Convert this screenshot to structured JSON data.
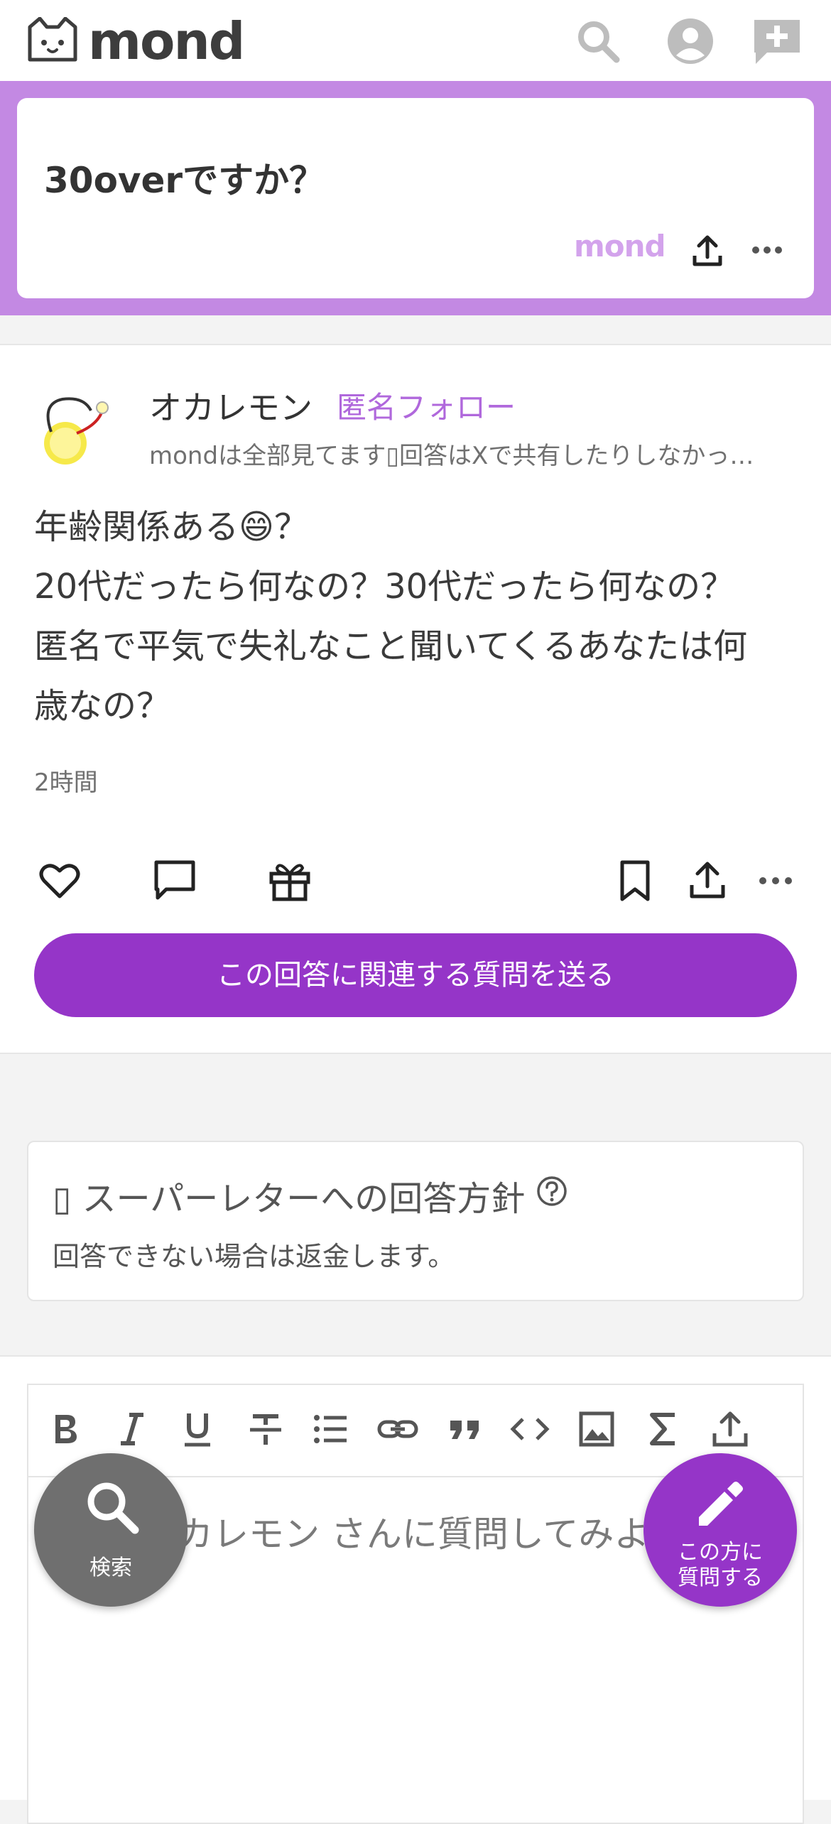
{
  "header": {
    "logo_text": "mond",
    "icons": [
      "search-icon",
      "account-icon",
      "new-question-icon"
    ]
  },
  "question": {
    "text": "30overですか？",
    "watermark": "mond"
  },
  "answer": {
    "user_name": "オカレモン",
    "follow_label": "匿名フォロー",
    "bio": "mondは全部見てます▯回答はXで共有したりしなかっ…",
    "body_lines": [
      "年齢関係ある😄？",
      "20代だったら何なの？30代だったら何なの？",
      "匿名で平気で失礼なこと聞いてくるあなたは何",
      "歳なの？"
    ],
    "time_ago": "2時間",
    "cta_label": "この回答に関連する質問を送る"
  },
  "policy": {
    "title": "▯ スーパーレターへの回答方針",
    "subtitle": "回答できない場合は返金します。"
  },
  "editor": {
    "placeholder": "オカレモン さんに質問してみよう",
    "toolbar": [
      "bold",
      "italic",
      "underline",
      "strikethrough",
      "bullet-list",
      "link",
      "quote",
      "code",
      "image",
      "sigma",
      "upload"
    ]
  },
  "fab": {
    "search_label": "検索",
    "ask_label_line1": "この方に",
    "ask_label_line2": "質問する"
  },
  "colors": {
    "accent": "#9535c8",
    "banner": "#c389e3",
    "follow": "#b068dc"
  }
}
